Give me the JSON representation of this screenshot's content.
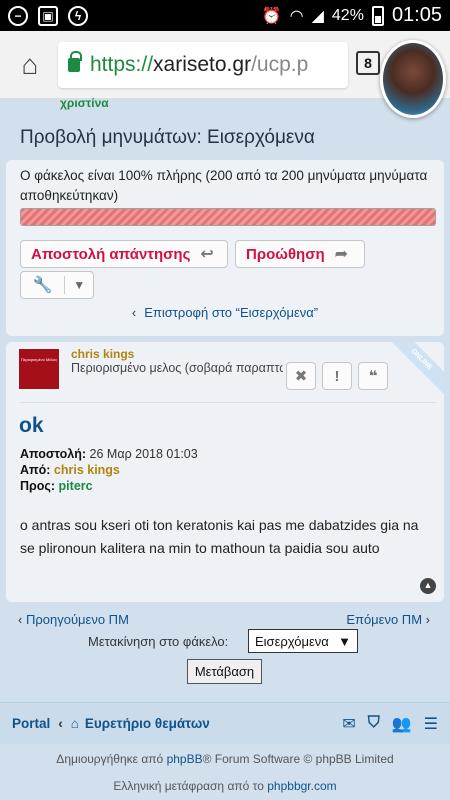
{
  "status_bar": {
    "battery": "42%",
    "time": "01:05"
  },
  "browser": {
    "url_scheme": "https://",
    "url_host": "xariseto.gr",
    "url_path": "/ucp.p",
    "tab_count": "8"
  },
  "header": {
    "username": "χριστίνα",
    "page_title": "Προβολή μηνυμάτων: Εισερχόμενα"
  },
  "quota": {
    "text": "Ο φάκελος είναι 100% πλήρης (200 από τα 200 μηνύματα μηνύματα αποθηκεύτηκαν)",
    "percent_full": 100
  },
  "actions": {
    "reply_label": "Αποστολή απάντησης",
    "forward_label": "Προώθηση",
    "return_link": "Επιστροφή στο “Εισερχόμενα”"
  },
  "post": {
    "rank_image_text": "Περιορισμένο Μέλος",
    "author": "chris kings",
    "author_rank": "Περιορισμένο μελος (σοβαρά παραπτώματα)",
    "online_label": "ONLINE",
    "subject": "ok",
    "date_label": "Αποστολή:",
    "date": "26 Μαρ 2018 01:03",
    "from_label": "Από:",
    "from": "chris kings",
    "to_label": "Προς:",
    "to": "piterc",
    "body": "o antras sou kseri oti ton keratonis kai pas me dabatzides gia na se plironoun kalitera na min to mathoun ta paidia sou auto"
  },
  "pm_nav": {
    "prev_label": "Προηγούμενο ΠΜ",
    "next_label": "Επόμενο ΠΜ",
    "move_label": "Μετακίνηση στο φάκελο:",
    "folder_selected": "Εισερχόμενα",
    "go_label": "Μετάβαση"
  },
  "footer": {
    "portal_label": "Portal",
    "index_label": "Ευρετήριο θεμάτων",
    "credit_prefix": "Δημιουργήθηκε από ",
    "credit_link": "phpBB",
    "credit_suffix": "® Forum Software © phpBB Limited",
    "translation_prefix": "Ελληνική μετάφραση από το ",
    "translation_link": "phpbbgr.com"
  },
  "colors": {
    "accent_red": "#d31141",
    "link_blue": "#105289",
    "green": "#1c8b3f",
    "gold": "#b3840e",
    "page_bg": "#d2e0ee"
  }
}
